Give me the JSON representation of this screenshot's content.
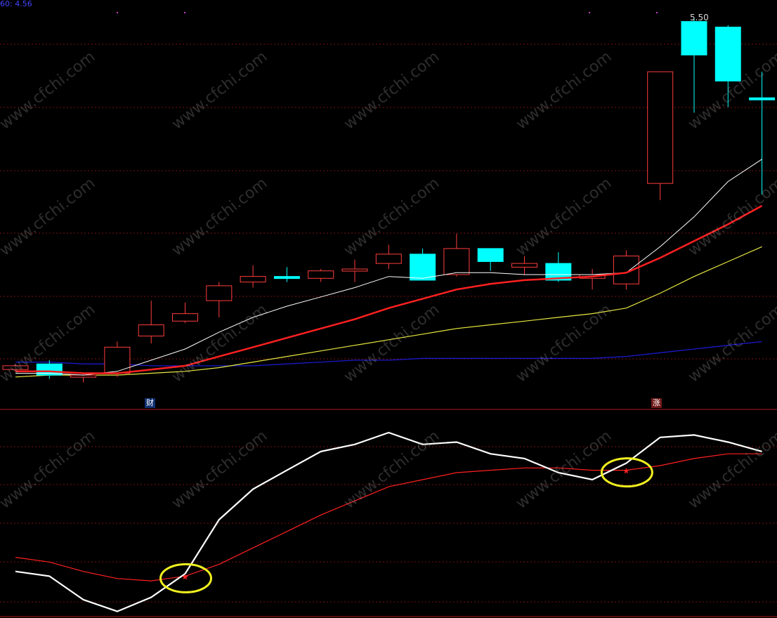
{
  "ma_label": "60: 4.56",
  "price_annotation": "5.50",
  "markers": [
    "财",
    "涨"
  ],
  "watermark": "www.cfchi.com",
  "colors": {
    "background": "#000000",
    "grid": "#7a1010",
    "up_candle": "#ff3c3c",
    "down_candle": "#00ffff",
    "ma_white": "#ffffff",
    "ma_red": "#ff2020",
    "ma_yellow": "#e8e840",
    "ma_blue": "#1a1acc",
    "osc_white": "#ffffff",
    "osc_red": "#ff2020",
    "circle": "#f0f020"
  },
  "chart_data": [
    {
      "type": "candlestick",
      "price_axis": [
        3.5,
        5.5
      ],
      "candles": [
        {
          "open": 3.59,
          "close": 3.61,
          "high": 3.62,
          "low": 3.58,
          "dir": "up"
        },
        {
          "open": 3.62,
          "close": 3.56,
          "high": 3.64,
          "low": 3.54,
          "dir": "down"
        },
        {
          "open": 3.55,
          "close": 3.56,
          "high": 3.57,
          "low": 3.52,
          "dir": "up"
        },
        {
          "open": 3.57,
          "close": 3.71,
          "high": 3.74,
          "low": 3.55,
          "dir": "up"
        },
        {
          "open": 3.77,
          "close": 3.83,
          "high": 3.96,
          "low": 3.73,
          "dir": "up"
        },
        {
          "open": 3.85,
          "close": 3.89,
          "high": 3.95,
          "low": 3.84,
          "dir": "up"
        },
        {
          "open": 3.96,
          "close": 4.04,
          "high": 4.06,
          "low": 3.87,
          "dir": "up"
        },
        {
          "open": 4.06,
          "close": 4.09,
          "high": 4.15,
          "low": 4.03,
          "dir": "up"
        },
        {
          "open": 4.09,
          "close": 4.08,
          "high": 4.14,
          "low": 4.06,
          "dir": "down"
        },
        {
          "open": 4.08,
          "close": 4.12,
          "high": 4.13,
          "low": 4.06,
          "dir": "up"
        },
        {
          "open": 4.12,
          "close": 4.13,
          "high": 4.18,
          "low": 4.06,
          "dir": "up"
        },
        {
          "open": 4.16,
          "close": 4.21,
          "high": 4.26,
          "low": 4.13,
          "dir": "up"
        },
        {
          "open": 4.21,
          "close": 4.07,
          "high": 4.24,
          "low": 4.07,
          "dir": "down"
        },
        {
          "open": 4.1,
          "close": 4.24,
          "high": 4.32,
          "low": 4.09,
          "dir": "up"
        },
        {
          "open": 4.24,
          "close": 4.17,
          "high": 4.24,
          "low": 4.12,
          "dir": "down"
        },
        {
          "open": 4.14,
          "close": 4.16,
          "high": 4.2,
          "low": 4.1,
          "dir": "up"
        },
        {
          "open": 4.16,
          "close": 4.07,
          "high": 4.22,
          "low": 4.06,
          "dir": "down"
        },
        {
          "open": 4.08,
          "close": 4.1,
          "high": 4.13,
          "low": 4.02,
          "dir": "up"
        },
        {
          "open": 4.05,
          "close": 4.2,
          "high": 4.23,
          "low": 4.02,
          "dir": "up"
        },
        {
          "open": 4.59,
          "close": 5.19,
          "high": 5.19,
          "low": 4.5,
          "dir": "up"
        },
        {
          "open": 5.46,
          "close": 5.28,
          "high": 5.48,
          "low": 4.97,
          "dir": "down"
        },
        {
          "open": 5.43,
          "close": 5.14,
          "high": 5.44,
          "low": 5.0,
          "dir": "down"
        },
        {
          "open": 5.05,
          "close": 5.04,
          "high": 5.19,
          "low": 4.53,
          "dir": "down"
        }
      ],
      "ma_white": [
        3.57,
        3.57,
        3.56,
        3.58,
        3.64,
        3.7,
        3.79,
        3.87,
        3.93,
        3.98,
        4.03,
        4.09,
        4.08,
        4.11,
        4.11,
        4.1,
        4.1,
        4.1,
        4.11,
        4.25,
        4.41,
        4.6,
        4.72
      ],
      "ma_red": [
        3.58,
        3.58,
        3.57,
        3.57,
        3.59,
        3.61,
        3.66,
        3.71,
        3.76,
        3.81,
        3.86,
        3.92,
        3.97,
        4.02,
        4.05,
        4.07,
        4.08,
        4.09,
        4.11,
        4.19,
        4.28,
        4.37,
        4.47
      ],
      "ma_yellow": [
        3.55,
        3.56,
        3.56,
        3.56,
        3.57,
        3.58,
        3.6,
        3.63,
        3.66,
        3.69,
        3.72,
        3.75,
        3.78,
        3.81,
        3.83,
        3.85,
        3.87,
        3.89,
        3.92,
        4.0,
        4.09,
        4.17,
        4.25
      ],
      "ma_blue": [
        3.63,
        3.63,
        3.62,
        3.62,
        3.61,
        3.61,
        3.61,
        3.61,
        3.62,
        3.63,
        3.64,
        3.64,
        3.65,
        3.65,
        3.65,
        3.65,
        3.65,
        3.65,
        3.66,
        3.68,
        3.7,
        3.72,
        3.74
      ]
    },
    {
      "type": "line",
      "series": [
        {
          "values": [
            18,
            16,
            6,
            1,
            7,
            17,
            40,
            53,
            61,
            69,
            72,
            77,
            72,
            73,
            68,
            66,
            60,
            57,
            64,
            75,
            76,
            73,
            69
          ]
        },
        {
          "values": [
            24,
            22,
            18,
            15,
            14,
            16,
            21,
            28,
            35,
            42,
            48,
            54,
            57,
            60,
            61,
            62,
            62,
            61,
            61,
            63,
            66,
            68,
            68
          ]
        }
      ],
      "crossover_markers": [
        5,
        18
      ]
    }
  ]
}
